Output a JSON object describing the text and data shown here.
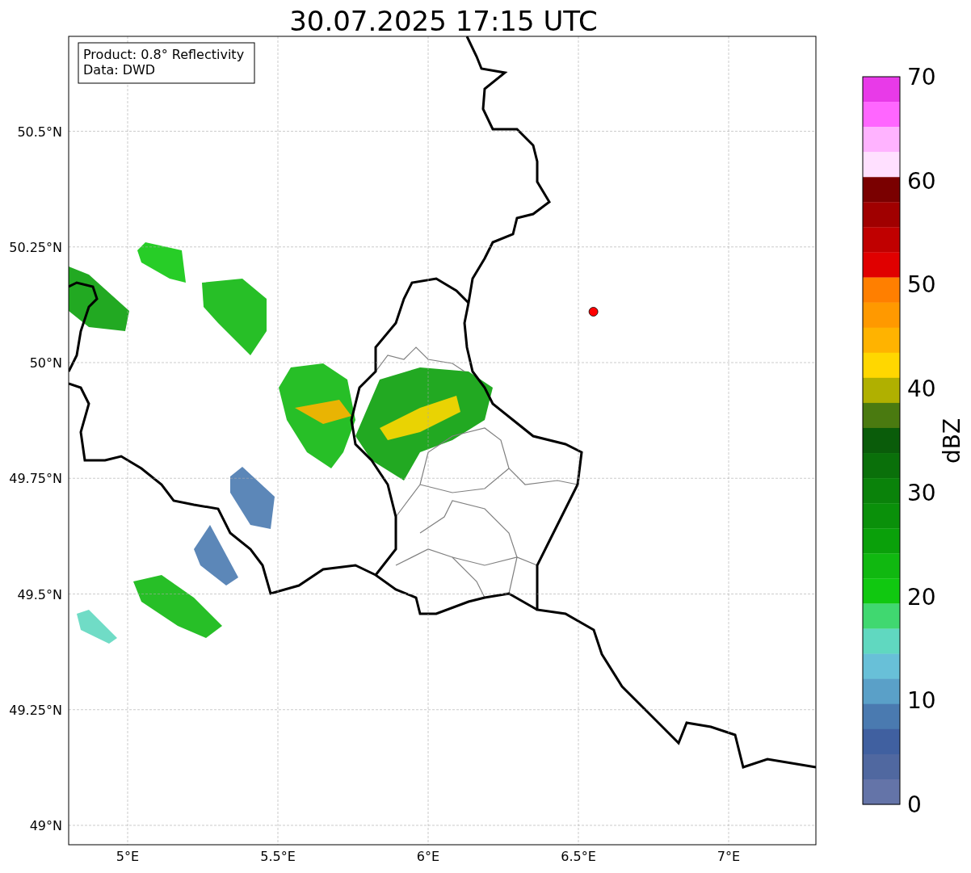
{
  "title": "30.07.2025 17:15 UTC",
  "info_box": {
    "lines": [
      "Product: 0.8° Reflectivity",
      "Data: DWD"
    ]
  },
  "map": {
    "lat_ticks": [
      "50.5°N",
      "50.25°N",
      "50°N",
      "49.75°N",
      "49.5°N",
      "49.25°N",
      "49°N"
    ],
    "lon_ticks": [
      "5°E",
      "5.5°E",
      "6°E",
      "6.5°E",
      "7°E"
    ],
    "marker": {
      "color": "#ff0000"
    }
  },
  "colorbar": {
    "label": "dBZ",
    "ticks": [
      "70",
      "60",
      "50",
      "40",
      "30",
      "20",
      "10",
      "0"
    ],
    "bands": [
      {
        "color": "#e83ae8"
      },
      {
        "color": "#ff66ff"
      },
      {
        "color": "#ffb3ff"
      },
      {
        "color": "#ffe0ff"
      },
      {
        "color": "#7a0000"
      },
      {
        "color": "#a00000"
      },
      {
        "color": "#c00000"
      },
      {
        "color": "#e00000"
      },
      {
        "color": "#ff7f00"
      },
      {
        "color": "#ff9900"
      },
      {
        "color": "#ffb300"
      },
      {
        "color": "#ffd700"
      },
      {
        "color": "#b0b000"
      },
      {
        "color": "#4a7a10"
      },
      {
        "color": "#0a5c0a"
      },
      {
        "color": "#0a700a"
      },
      {
        "color": "#0a820a"
      },
      {
        "color": "#0a900a"
      },
      {
        "color": "#0aa00a"
      },
      {
        "color": "#10b810"
      },
      {
        "color": "#10c810"
      },
      {
        "color": "#40d870"
      },
      {
        "color": "#60d8c0"
      },
      {
        "color": "#68c0d8"
      },
      {
        "color": "#5aa0c8"
      },
      {
        "color": "#4a7ab0"
      },
      {
        "color": "#4060a0"
      },
      {
        "color": "#5068a0"
      },
      {
        "color": "#6474a8"
      }
    ]
  }
}
